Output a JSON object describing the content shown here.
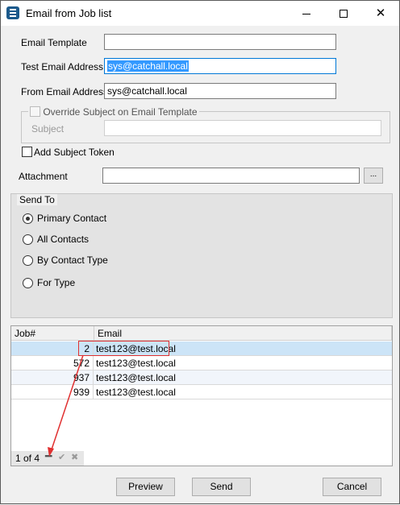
{
  "window": {
    "title": "Email from Job list",
    "icon": "app-logo-icon"
  },
  "form": {
    "email_template_label": "Email Template",
    "email_template_value": "",
    "test_email_label": "Test Email Address",
    "test_email_value": "sys@catchall.local",
    "from_email_label": "From Email Address",
    "from_email_value": "sys@catchall.local",
    "override_subject_label": "Override Subject on Email Template",
    "override_subject_checked": false,
    "subject_label": "Subject",
    "subject_value": "",
    "add_subject_token_label": "Add Subject Token",
    "add_subject_token_checked": false,
    "attachment_label": "Attachment",
    "attachment_value": "",
    "browse_label": "..."
  },
  "send_to": {
    "legend": "Send To",
    "options": [
      {
        "label": "Primary Contact",
        "checked": true
      },
      {
        "label": "All Contacts",
        "checked": false
      },
      {
        "label": "By Contact Type",
        "checked": false
      },
      {
        "label": "For Type",
        "checked": false
      }
    ]
  },
  "grid": {
    "headers": [
      "Job#",
      "Email"
    ],
    "rows": [
      {
        "job": "2",
        "email": "test123@test.local"
      },
      {
        "job": "572",
        "email": "test123@test.local"
      },
      {
        "job": "937",
        "email": "test123@test.local"
      },
      {
        "job": "939",
        "email": "test123@test.local"
      }
    ]
  },
  "pager": {
    "text": "1 of 4"
  },
  "buttons": {
    "preview": "Preview",
    "send": "Send",
    "cancel": "Cancel"
  },
  "colors": {
    "selection": "#3399ff",
    "annotation": "#e03030",
    "selected_row": "#cce4f7",
    "focus_border": "#0078d7"
  }
}
